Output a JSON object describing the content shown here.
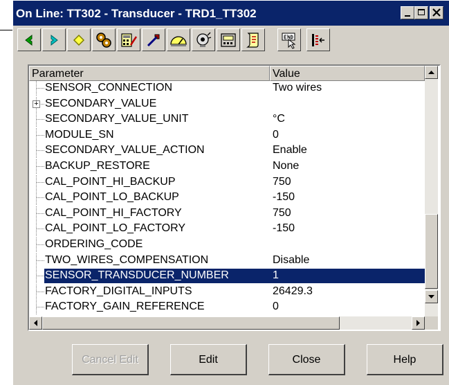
{
  "window": {
    "title": "On Line: TT302 - Transducer - TRD1_TT302",
    "controls": [
      "minimize-icon",
      "maximize-icon",
      "close-icon"
    ]
  },
  "toolbar": {
    "buttons": [
      {
        "icon": "back-arrow-icon"
      },
      {
        "icon": "forward-arrow-icon"
      },
      {
        "icon": "diamond-icon"
      },
      {
        "icon": "gears-icon"
      },
      {
        "icon": "calculator-edit-icon"
      },
      {
        "icon": "wrench-icon"
      },
      {
        "icon": "gauge-icon"
      },
      {
        "icon": "sensor-icon"
      },
      {
        "icon": "display-icon"
      },
      {
        "icon": "scroll-icon"
      },
      {
        "icon": "end-cursor-icon"
      },
      {
        "icon": "list-arrow-icon"
      }
    ]
  },
  "grid": {
    "headers": {
      "parameter": "Parameter",
      "value": "Value"
    },
    "rows": [
      {
        "name": "SENSOR_CONNECTION",
        "value": "Two wires"
      },
      {
        "name": "SECONDARY_VALUE",
        "value": "",
        "expandable": true
      },
      {
        "name": "SECONDARY_VALUE_UNIT",
        "value": "°C"
      },
      {
        "name": "MODULE_SN",
        "value": "0"
      },
      {
        "name": "SECONDARY_VALUE_ACTION",
        "value": "Enable"
      },
      {
        "name": "BACKUP_RESTORE",
        "value": "None"
      },
      {
        "name": "CAL_POINT_HI_BACKUP",
        "value": "750"
      },
      {
        "name": "CAL_POINT_LO_BACKUP",
        "value": "-150"
      },
      {
        "name": "CAL_POINT_HI_FACTORY",
        "value": "750"
      },
      {
        "name": "CAL_POINT_LO_FACTORY",
        "value": "-150"
      },
      {
        "name": "ORDERING_CODE",
        "value": ""
      },
      {
        "name": "TWO_WIRES_COMPENSATION",
        "value": "Disable"
      },
      {
        "name": "SENSOR_TRANSDUCER_NUMBER",
        "value": "1",
        "selected": true
      },
      {
        "name": "FACTORY_DIGITAL_INPUTS",
        "value": "26429.3"
      },
      {
        "name": "FACTORY_GAIN_REFERENCE",
        "value": "0"
      }
    ]
  },
  "buttons": {
    "cancel_edit": "Cancel Edit",
    "edit": "Edit",
    "close": "Close",
    "help": "Help"
  }
}
